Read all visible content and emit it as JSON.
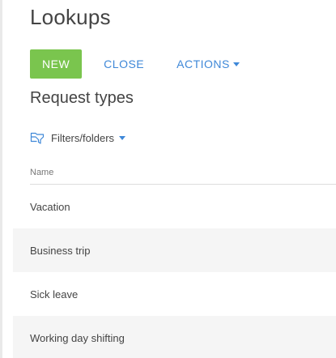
{
  "header": {
    "title": "Lookups"
  },
  "toolbar": {
    "new_label": "NEW",
    "close_label": "CLOSE",
    "actions_label": "ACTIONS"
  },
  "section": {
    "title": "Request types"
  },
  "filters": {
    "label": "Filters/folders",
    "icon": "filter-folder-icon"
  },
  "table": {
    "column_header": "Name",
    "rows": [
      "Vacation",
      "Business trip",
      "Sick leave",
      "Working day shifting"
    ]
  },
  "colors": {
    "accent_green": "#7ac54e",
    "link_blue": "#3f88d8",
    "text": "#444444",
    "row_alt": "#f5f5f5"
  }
}
